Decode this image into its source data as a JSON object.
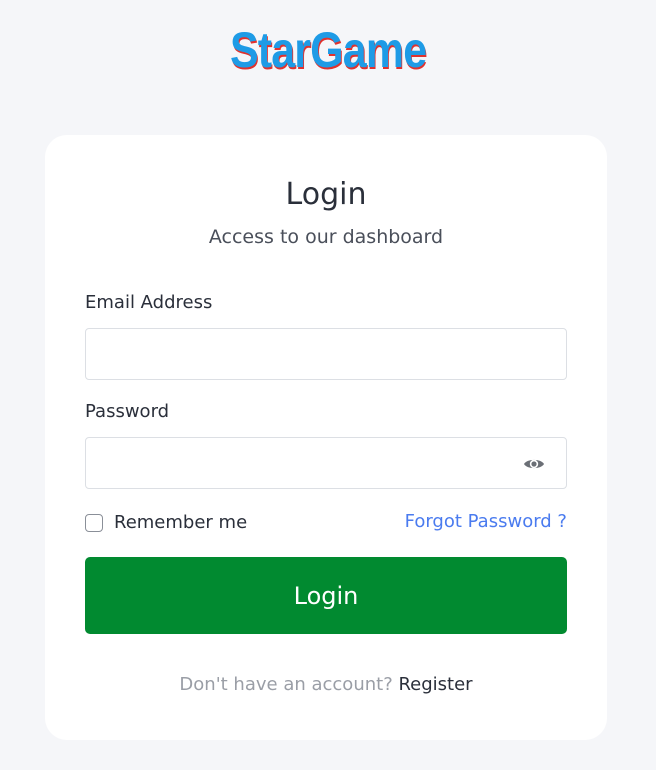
{
  "logo": {
    "text": "StarGame"
  },
  "login_card": {
    "title": "Login",
    "subtitle": "Access to our dashboard",
    "email": {
      "label": "Email Address",
      "value": "",
      "placeholder": ""
    },
    "password": {
      "label": "Password",
      "value": "",
      "placeholder": "",
      "toggle_icon": "eye-icon"
    },
    "remember_label": "Remember me",
    "remember_checked": false,
    "forgot_label": "Forgot Password ?",
    "submit_label": "Login",
    "footer_text": "Don't have an account?",
    "register_label": "Register"
  },
  "colors": {
    "background": "#f5f6f9",
    "card": "#ffffff",
    "primary_button": "#018a30",
    "link": "#4a7bef",
    "logo_blue": "#1e9be6",
    "logo_shadow": "#e0322e"
  }
}
